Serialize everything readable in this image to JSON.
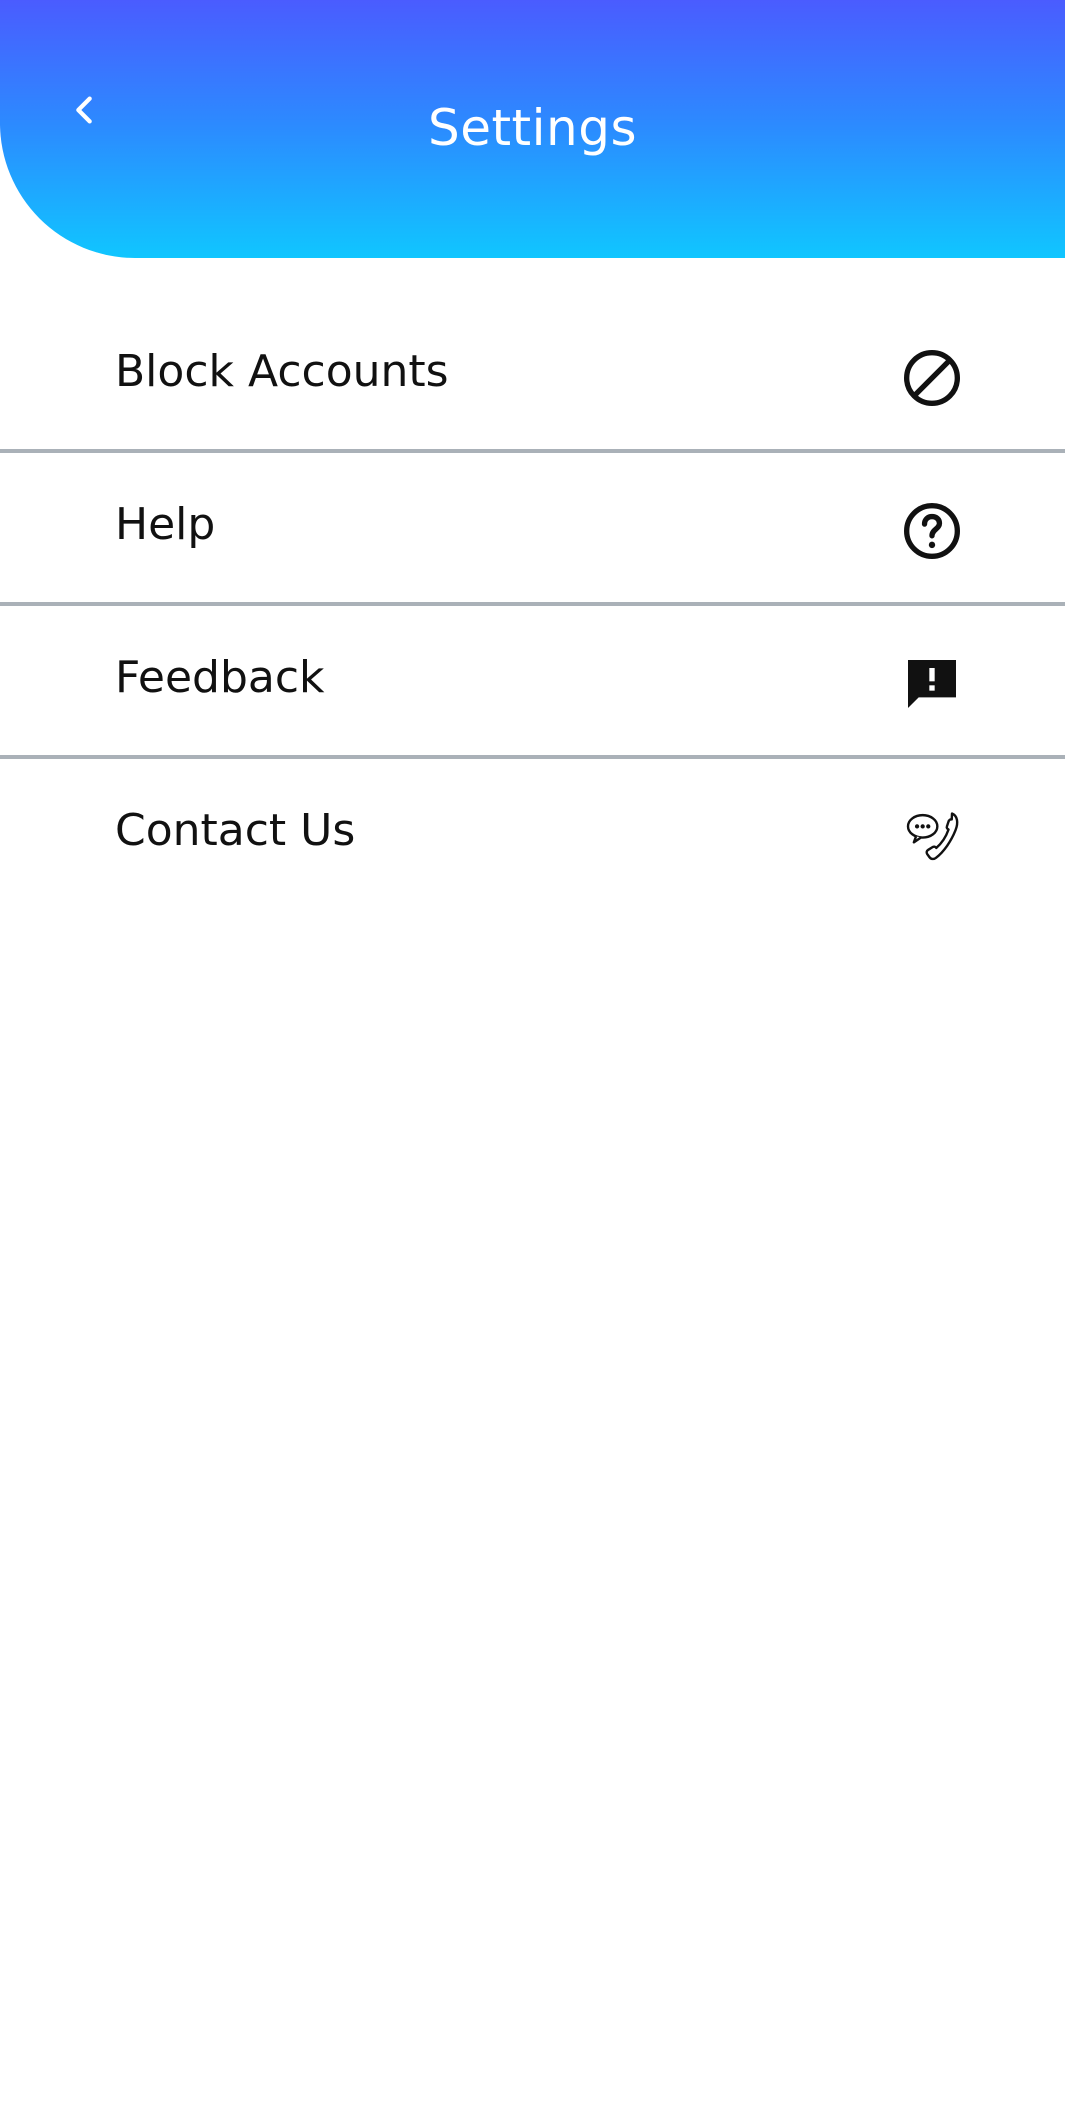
{
  "header": {
    "title": "Settings",
    "back_icon": "chevron-left-icon",
    "gradient_colors": [
      "#4a5cff",
      "#10c6ff"
    ]
  },
  "menu": {
    "items": [
      {
        "label": "Block Accounts",
        "icon": "block-icon"
      },
      {
        "label": "Help",
        "icon": "help-circle-icon"
      },
      {
        "label": "Feedback",
        "icon": "feedback-icon"
      },
      {
        "label": "Contact Us",
        "icon": "contact-phone-icon"
      }
    ]
  }
}
